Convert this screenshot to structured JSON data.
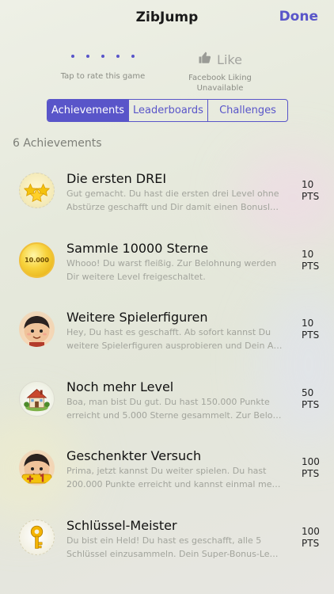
{
  "nav": {
    "title": "ZibJump",
    "done_label": "Done"
  },
  "rate": {
    "label": "Tap to rate this game"
  },
  "like": {
    "label": "Like",
    "sub1": "Facebook Liking",
    "sub2": "Unavailable"
  },
  "tabs": [
    {
      "label": "Achievements",
      "selected": true
    },
    {
      "label": "Leaderboards",
      "selected": false
    },
    {
      "label": "Challenges",
      "selected": false
    }
  ],
  "count_label": "6 Achievements",
  "coin_text": "10.000",
  "achievements": [
    {
      "icon": "stars-icon",
      "title": "Die ersten DREI",
      "desc": "Gut gemacht. Du hast die ersten drei Level ohne Abstürze geschafft und Dir damit einen Bonusl…",
      "points": "10",
      "pts_label": "PTS"
    },
    {
      "icon": "coin-icon",
      "title": "Sammle 10000 Sterne",
      "desc": "Whooo! Du warst fleißig. Zur Belohnung werden Dir weitere Level freigeschaltet.",
      "points": "10",
      "pts_label": "PTS"
    },
    {
      "icon": "character-icon",
      "title": "Weitere Spielerfiguren",
      "desc": "Hey, Du hast es geschafft. Ab sofort kannst Du weitere Spielerfiguren ausprobieren und Dein A…",
      "points": "10",
      "pts_label": "PTS"
    },
    {
      "icon": "house-icon",
      "title": "Noch mehr Level",
      "desc": "Boa, man bist Du gut. Du hast 150.000 Punkte erreicht und 5.000 Sterne gesammelt. Zur Belo…",
      "points": "50",
      "pts_label": "PTS"
    },
    {
      "icon": "extra-life-icon",
      "title": "Geschenkter Versuch",
      "desc": "Prima, jetzt kannst Du weiter spielen. Du hast 200.000 Punkte erreicht und kannst einmal me…",
      "points": "100",
      "pts_label": "PTS"
    },
    {
      "icon": "key-icon",
      "title": "Schlüssel-Meister",
      "desc": "Du bist ein Held! Du hast es geschafft, alle 5 Schlüssel einzusammeln. Dein Super-Bonus-Le…",
      "points": "100",
      "pts_label": "PTS"
    }
  ],
  "colors": {
    "accent": "#5955c9",
    "secondary_text": "#a2a49c"
  }
}
